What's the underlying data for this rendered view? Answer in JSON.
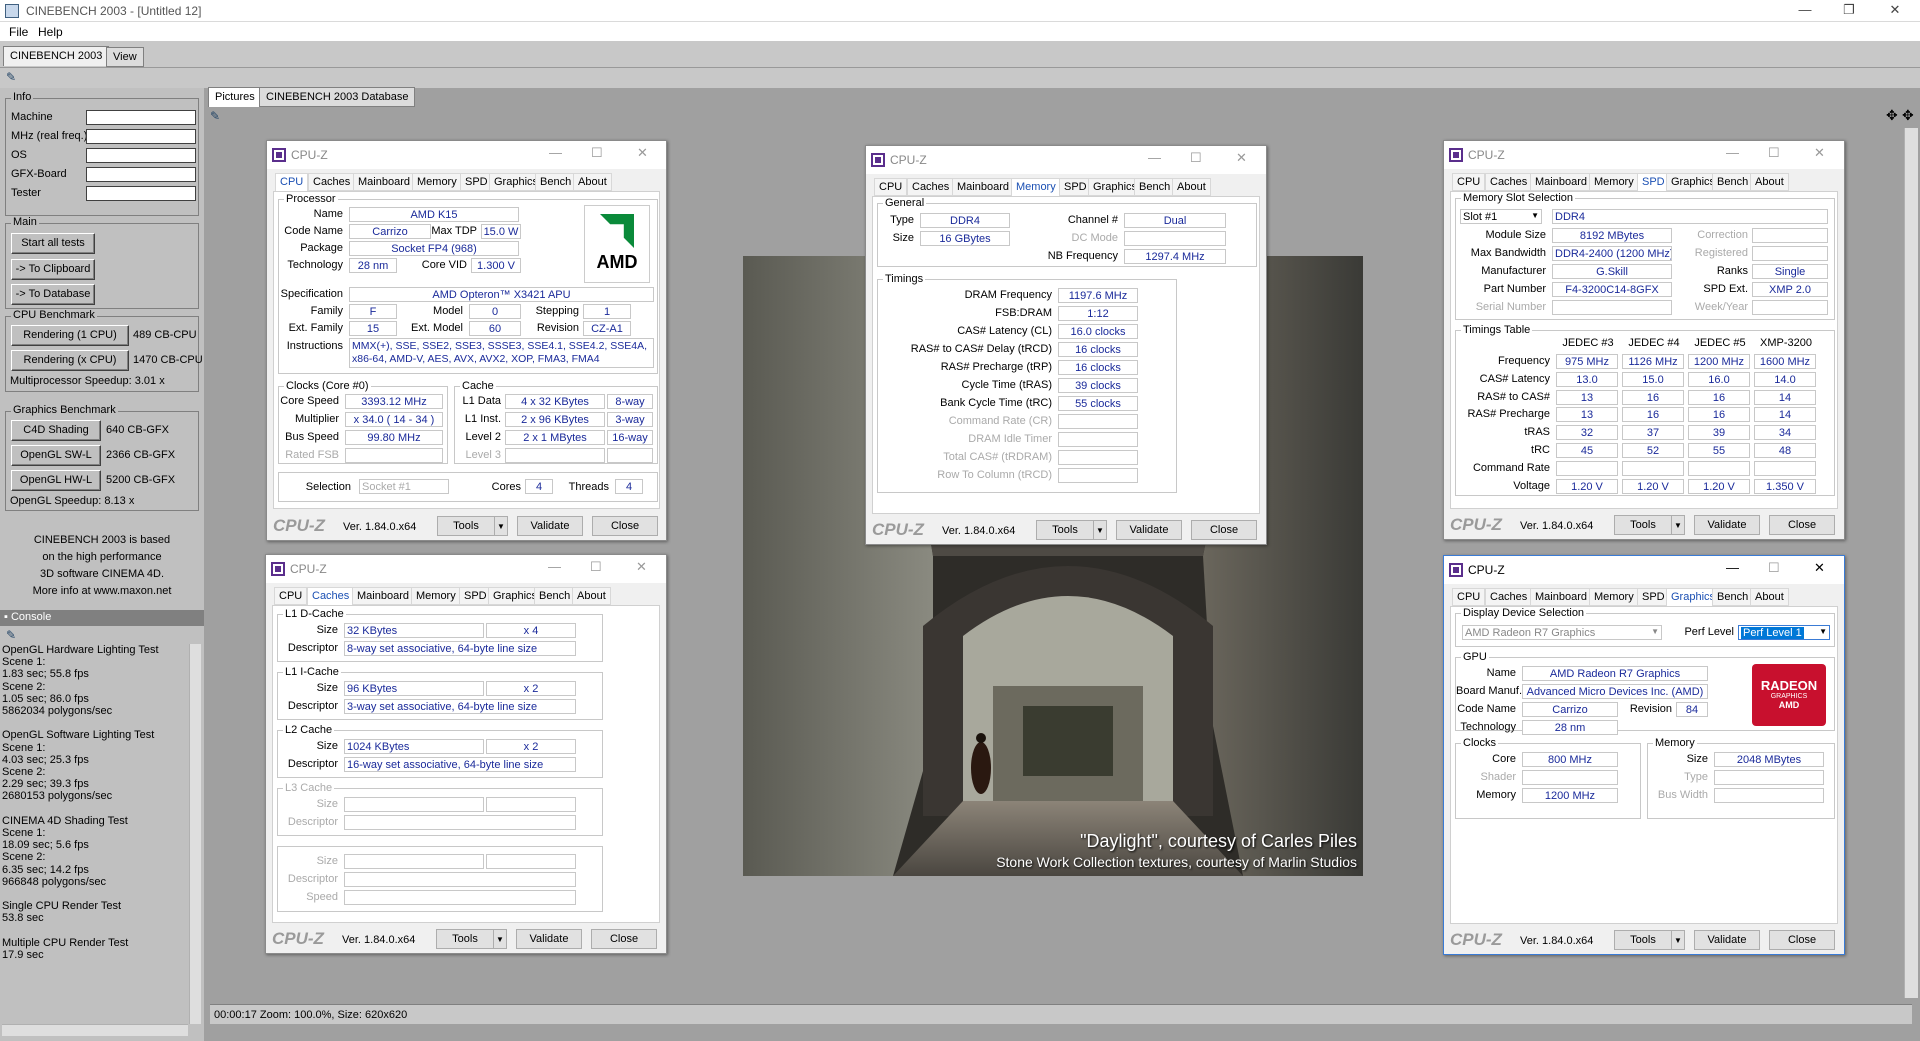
{
  "window": {
    "title": "CINEBENCH 2003 - [Untitled 12]",
    "min": "—",
    "max": "❐",
    "close": "✕"
  },
  "menu": [
    "File",
    "Help"
  ],
  "main_tabs": [
    "CINEBENCH 2003",
    "View"
  ],
  "view_tabs": [
    "Pictures",
    "CINEBENCH 2003 Database"
  ],
  "info": {
    "title": "Info",
    "labels": [
      "Machine",
      "MHz (real freq.)",
      "OS",
      "GFX-Board",
      "Tester"
    ]
  },
  "main": {
    "title": "Main",
    "start": "Start all tests",
    "clip": "-> To Clipboard",
    "db": "-> To Database"
  },
  "cpu_bench": {
    "title": "CPU Benchmark",
    "r1": "Rendering (1 CPU)",
    "r1v": "489 CB-CPU",
    "rx": "Rendering (x CPU)",
    "rxv": "1470 CB-CPU",
    "mp": "Multiprocessor Speedup:  3.01 x"
  },
  "gfx_bench": {
    "title": "Graphics Benchmark",
    "c4d": "C4D Shading",
    "c4dv": "640 CB-GFX",
    "sw": "OpenGL SW-L",
    "swv": "2366 CB-GFX",
    "hw": "OpenGL HW-L",
    "hwv": "5200 CB-GFX",
    "sp": "OpenGL Speedup:  8.13 x"
  },
  "about": [
    "CINEBENCH 2003 is based",
    "on the high performance",
    "3D software CINEMA 4D.",
    "More info at www.maxon.net"
  ],
  "console": {
    "title": "Console",
    "lines": [
      "OpenGL Hardware Lighting Test",
      "Scene 1:",
      "1.83 sec; 55.8 fps",
      "Scene 2:",
      "1.05 sec; 86.0 fps",
      "5862034 polygons/sec",
      "",
      "OpenGL Software Lighting Test",
      "Scene 1:",
      "4.03 sec; 25.3 fps",
      "Scene 2:",
      "2.29 sec; 39.3 fps",
      "2680153 polygons/sec",
      "",
      "CINEMA 4D Shading Test",
      "Scene 1:",
      "18.09 sec; 5.6 fps",
      "Scene 2:",
      "6.35 sec; 14.2 fps",
      "966848 polygons/sec",
      "",
      "Single CPU Render Test",
      "53.8 sec",
      "",
      "Multiple CPU Render Test",
      "17.9 sec"
    ]
  },
  "status": "00:00:17  Zoom: 100.0%, Size: 620x620",
  "render": {
    "caption1": "\"Daylight\", courtesy of Carles Piles",
    "caption2": "Stone Work Collection textures, courtesy of Marlin Studios"
  },
  "cpuz_common": {
    "name": "CPU-Z",
    "ver": "Ver. 1.84.0.x64",
    "tools": "Tools",
    "validate": "Validate",
    "close": "Close",
    "tabs": [
      "CPU",
      "Caches",
      "Mainboard",
      "Memory",
      "SPD",
      "Graphics",
      "Bench",
      "About"
    ]
  },
  "cpu": {
    "processor": "Processor",
    "name_k": "Name",
    "name": "AMD K15",
    "code_k": "Code Name",
    "code": "Carrizo",
    "tdp_k": "Max TDP",
    "tdp": "15.0 W",
    "pkg_k": "Package",
    "pkg": "Socket FP4 (968)",
    "tech_k": "Technology",
    "tech": "28 nm",
    "vid_k": "Core VID",
    "vid": "1.300 V",
    "spec_k": "Specification",
    "spec": "AMD Opteron™ X3421 APU",
    "fam_k": "Family",
    "fam": "F",
    "model_k": "Model",
    "model": "0",
    "step_k": "Stepping",
    "step": "1",
    "efam_k": "Ext. Family",
    "efam": "15",
    "emod_k": "Ext. Model",
    "emod": "60",
    "rev_k": "Revision",
    "rev": "CZ-A1",
    "ins_k": "Instructions",
    "ins": "MMX(+), SSE, SSE2, SSE3, SSSE3, SSE4.1, SSE4.2, SSE4A, x86-64, AMD-V, AES, AVX, AVX2, XOP, FMA3, FMA4",
    "clocks": "Clocks (Core #0)",
    "cs_k": "Core Speed",
    "cs": "3393.12 MHz",
    "mul_k": "Multiplier",
    "mul": "x 34.0 ( 14 - 34 )",
    "bus_k": "Bus Speed",
    "bus": "99.80 MHz",
    "fsb_k": "Rated FSB",
    "cache": "Cache",
    "l1d_k": "L1 Data",
    "l1d": "4 x 32 KBytes",
    "l1d_w": "8-way",
    "l1i_k": "L1 Inst.",
    "l1i": "2 x 96 KBytes",
    "l1i_w": "3-way",
    "l2_k": "Level 2",
    "l2": "2 x 1 MBytes",
    "l2_w": "16-way",
    "l3_k": "Level 3",
    "sel_k": "Selection",
    "sel": "Socket #1",
    "cores_k": "Cores",
    "cores": "4",
    "thr_k": "Threads",
    "thr": "4",
    "logo": "AMD"
  },
  "caches": {
    "l1d": "L1 D-Cache",
    "l1i": "L1 I-Cache",
    "l2": "L2 Cache",
    "l3": "L3 Cache",
    "size": "Size",
    "desc": "Descriptor",
    "speed": "Speed",
    "l1d_size": "32 KBytes",
    "l1d_x": "x 4",
    "l1d_desc": "8-way set associative, 64-byte line size",
    "l1i_size": "96 KBytes",
    "l1i_x": "x 2",
    "l1i_desc": "3-way set associative, 64-byte line size",
    "l2_size": "1024 KBytes",
    "l2_x": "x 2",
    "l2_desc": "16-way set associative, 64-byte line size"
  },
  "memory": {
    "general": "General",
    "type_k": "Type",
    "type": "DDR4",
    "ch_k": "Channel #",
    "ch": "Dual",
    "size_k": "Size",
    "size": "16 GBytes",
    "dc_k": "DC Mode",
    "nb_k": "NB Frequency",
    "nb": "1297.4 MHz",
    "timings": "Timings",
    "rows": [
      [
        "DRAM Frequency",
        "1197.6 MHz"
      ],
      [
        "FSB:DRAM",
        "1:12"
      ],
      [
        "CAS# Latency (CL)",
        "16.0 clocks"
      ],
      [
        "RAS# to CAS# Delay (tRCD)",
        "16 clocks"
      ],
      [
        "RAS# Precharge (tRP)",
        "16 clocks"
      ],
      [
        "Cycle Time (tRAS)",
        "39 clocks"
      ],
      [
        "Bank Cycle Time (tRC)",
        "55 clocks"
      ],
      [
        "Command Rate (CR)",
        ""
      ],
      [
        "DRAM Idle Timer",
        ""
      ],
      [
        "Total CAS# (tRDRAM)",
        ""
      ],
      [
        "Row To Column (tRCD)",
        ""
      ]
    ]
  },
  "spd": {
    "slotsel": "Memory Slot Selection",
    "slot": "Slot #1",
    "type": "DDR4",
    "mod_k": "Module Size",
    "mod": "8192 MBytes",
    "corr_k": "Correction",
    "bw_k": "Max Bandwidth",
    "bw": "DDR4-2400 (1200 MHz)",
    "reg_k": "Registered",
    "mfr_k": "Manufacturer",
    "mfr": "G.Skill",
    "ranks_k": "Ranks",
    "ranks": "Single",
    "pn_k": "Part Number",
    "pn": "F4-3200C14-8GFX",
    "ext_k": "SPD Ext.",
    "ext": "XMP 2.0",
    "sn_k": "Serial Number",
    "wk_k": "Week/Year",
    "tt": "Timings Table",
    "cols": [
      "JEDEC #3",
      "JEDEC #4",
      "JEDEC #5",
      "XMP-3200"
    ],
    "rows": [
      [
        "Frequency",
        "975 MHz",
        "1126 MHz",
        "1200 MHz",
        "1600 MHz"
      ],
      [
        "CAS# Latency",
        "13.0",
        "15.0",
        "16.0",
        "14.0"
      ],
      [
        "RAS# to CAS#",
        "13",
        "16",
        "16",
        "14"
      ],
      [
        "RAS# Precharge",
        "13",
        "16",
        "16",
        "14"
      ],
      [
        "tRAS",
        "32",
        "37",
        "39",
        "34"
      ],
      [
        "tRC",
        "45",
        "52",
        "55",
        "48"
      ],
      [
        "Command Rate",
        "",
        "",
        "",
        ""
      ],
      [
        "Voltage",
        "1.20 V",
        "1.20 V",
        "1.20 V",
        "1.350 V"
      ]
    ]
  },
  "gfx": {
    "dds": "Display Device Selection",
    "dev": "AMD Radeon R7 Graphics",
    "perf_k": "Perf Level",
    "perf": "Perf Level 1",
    "gpu": "GPU",
    "name_k": "Name",
    "name": "AMD Radeon R7 Graphics",
    "bm_k": "Board Manuf.",
    "bm": "Advanced Micro Devices Inc. (AMD)",
    "cn_k": "Code Name",
    "cn": "Carrizo",
    "rev_k": "Revision",
    "rev": "84",
    "tech_k": "Technology",
    "tech": "28 nm",
    "clocks": "Clocks",
    "core_k": "Core",
    "core": "800 MHz",
    "sh_k": "Shader",
    "mem_k": "Memory",
    "mem": "1200 MHz",
    "memg": "Memory",
    "msize_k": "Size",
    "msize": "2048 MBytes",
    "mtype_k": "Type",
    "mbw_k": "Bus Width",
    "logo1": "RADEON",
    "logo2": "GRAPHICS",
    "logo3": "AMD"
  }
}
